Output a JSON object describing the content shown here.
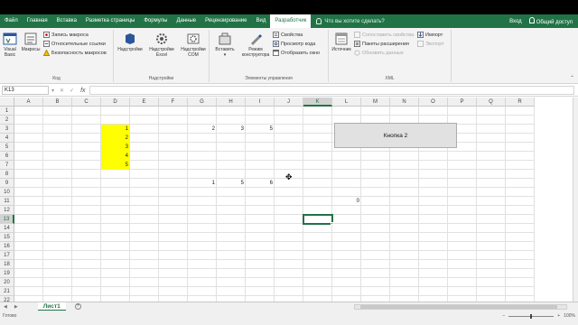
{
  "tabs": [
    "Файл",
    "Главная",
    "Вставка",
    "Разметка страницы",
    "Формулы",
    "Данные",
    "Рецензирование",
    "Вид",
    "Разработчик"
  ],
  "active_tab": "Разработчик",
  "tell_me": "Что вы хотите сделать?",
  "sign_in": "Вход",
  "share": "Общий доступ",
  "ribbon": {
    "code": {
      "label": "Код",
      "visual_basic": "Visual Basic",
      "macros": "Макросы",
      "record_macro": "Запись макроса",
      "relative_refs": "Относительные ссылки",
      "macro_security": "Безопасность макросов"
    },
    "addins": {
      "label": "Надстройки",
      "addins": "Надстройки",
      "excel_addins": "Надстройки Excel",
      "com_addins": "Надстройки COM"
    },
    "controls": {
      "label": "Элементы управления",
      "insert": "Вставить",
      "design_mode": "Режим конструктора",
      "properties": "Свойства",
      "view_code": "Просмотр кода",
      "show_window": "Отобразить окно"
    },
    "xml": {
      "label": "XML",
      "source": "Источник",
      "map_properties": "Сопоставить свойства",
      "expansion_packs": "Пакеты расширения",
      "refresh_data": "Обновить данные",
      "import": "Импорт",
      "export": "Экспорт"
    }
  },
  "formula_bar": {
    "name_box": "K13",
    "fx": "fx",
    "formula": ""
  },
  "columns": [
    "A",
    "B",
    "C",
    "D",
    "E",
    "F",
    "G",
    "H",
    "I",
    "J",
    "K",
    "L",
    "M",
    "N",
    "O",
    "P",
    "Q",
    "R"
  ],
  "rows": [
    "1",
    "2",
    "3",
    "4",
    "5",
    "6",
    "7",
    "8",
    "9",
    "10",
    "11",
    "12",
    "13",
    "14",
    "15",
    "16",
    "17",
    "18",
    "19",
    "20",
    "21",
    "22"
  ],
  "selected_cell": "K13",
  "cells": {
    "D3": "1",
    "D4": "2",
    "D5": "3",
    "D6": "4",
    "D7": "5",
    "G3": "2",
    "H3": "3",
    "I3": "5",
    "G9": "1",
    "H9": "5",
    "I9": "6",
    "L11": "0"
  },
  "highlight_color": "#FFFF00",
  "accent_color": "#217346",
  "button2_label": "Кнопка 2",
  "sheet_tab": "Лист1",
  "status_ready": "Готово",
  "zoom_level": "100%"
}
